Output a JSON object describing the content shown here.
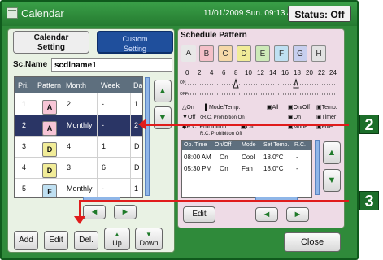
{
  "titlebar": {
    "title": "Calendar",
    "datetime": "11/01/2009 Sun. 09:13 AM",
    "status": "Status: Off"
  },
  "tabs": {
    "calendar_line1": "Calendar",
    "calendar_line2": "Setting",
    "custom_line1": "Custom",
    "custom_line2": "Setting"
  },
  "scname": {
    "label": "Sc.Name",
    "value": "scdlname1"
  },
  "list": {
    "headers": [
      "Pri.",
      "Pattern",
      "Month",
      "Week",
      "Da"
    ],
    "rows": [
      {
        "pri": "1",
        "pattern": "A",
        "month": "2",
        "week": "-",
        "day": "1"
      },
      {
        "pri": "2",
        "pattern": "A",
        "month": "Monthly",
        "week": "-",
        "day": "2"
      },
      {
        "pri": "3",
        "pattern": "D",
        "month": "4",
        "week": "1",
        "day": "D"
      },
      {
        "pri": "4",
        "pattern": "D",
        "month": "3",
        "week": "6",
        "day": "D"
      },
      {
        "pri": "5",
        "pattern": "F",
        "month": "Monthly",
        "week": "-",
        "day": "1"
      }
    ]
  },
  "buttons": {
    "add": "Add",
    "edit": "Edit",
    "del": "Del.",
    "up": "Up",
    "down": "Down",
    "close": "Close",
    "edit2": "Edit"
  },
  "schedule": {
    "title": "Schedule Pattern",
    "patterns": [
      "A",
      "B",
      "C",
      "D",
      "E",
      "F",
      "G",
      "H"
    ],
    "hours": [
      "0",
      "2",
      "4",
      "6",
      "8",
      "10",
      "12",
      "14",
      "16",
      "18",
      "20",
      "22",
      "24"
    ],
    "row_on_label": "ON",
    "row_off_label": "OFF",
    "legend": {
      "on": "On",
      "mode": "Mode/Temp.",
      "all": "All",
      "onoff": "On/Off",
      "temp": "Temp.",
      "off": "Off",
      "rc_proh_on": "R.C. Prohibition On",
      "on2": "On",
      "timer": "Timer",
      "rc_proh": "R.C. Prohibition",
      "off2": "Off",
      "rc_proh_off": "R.C. Prohibition Off",
      "mode2": "Mode",
      "filter": "Filter"
    },
    "op_headers": [
      "Op. Time",
      "On/Off",
      "Mode",
      "Set Temp.",
      "R.C."
    ],
    "op_rows": [
      {
        "time": "08:00 AM",
        "onoff": "On",
        "mode": "Cool",
        "temp": "18.0°C",
        "rc": "-"
      },
      {
        "time": "05:30 PM",
        "onoff": "On",
        "mode": "Fan",
        "temp": "18.0°C",
        "rc": "-"
      }
    ]
  },
  "callouts": {
    "two": "2",
    "three": "3"
  },
  "colors": {
    "frame_green": "#2f8a3a",
    "selected_row": "#2a3565",
    "callout_red": "#e01c1c",
    "custom_tab_blue": "#1f4f9c"
  }
}
